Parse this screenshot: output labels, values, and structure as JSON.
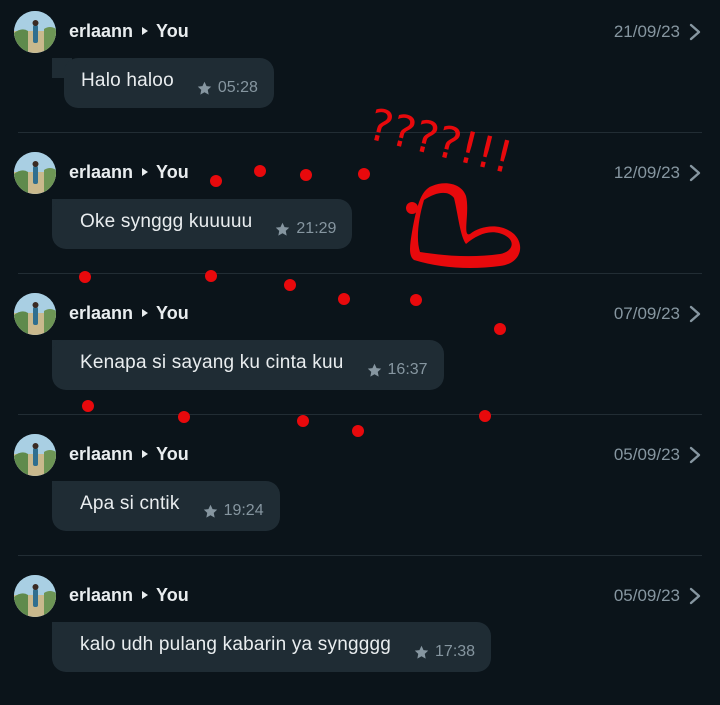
{
  "messages": [
    {
      "sender": "erlaann",
      "recipient": "You",
      "date": "21/09/23",
      "text": "Halo haloo",
      "time": "05:28"
    },
    {
      "sender": "erlaann",
      "recipient": "You",
      "date": "12/09/23",
      "text": "Oke synggg kuuuuu",
      "time": "21:29"
    },
    {
      "sender": "erlaann",
      "recipient": "You",
      "date": "07/09/23",
      "text": "Kenapa si sayang ku cinta kuu",
      "time": "16:37"
    },
    {
      "sender": "erlaann",
      "recipient": "You",
      "date": "05/09/23",
      "text": "Apa si cntik",
      "time": "19:24"
    },
    {
      "sender": "erlaann",
      "recipient": "You",
      "date": "05/09/23",
      "text": "kalo udh pulang kabarin ya syngggg",
      "time": "17:38"
    }
  ],
  "annotation": {
    "scribble_text": "????!!!",
    "color": "#e8090c"
  },
  "colors": {
    "background": "#0b141a",
    "bubble": "#1f2c34",
    "muted": "#8696a0",
    "text": "#e9edef"
  },
  "icons": {
    "star": "star-icon",
    "chevron": "chevron-right-icon",
    "arrow": "arrow-right-icon"
  }
}
